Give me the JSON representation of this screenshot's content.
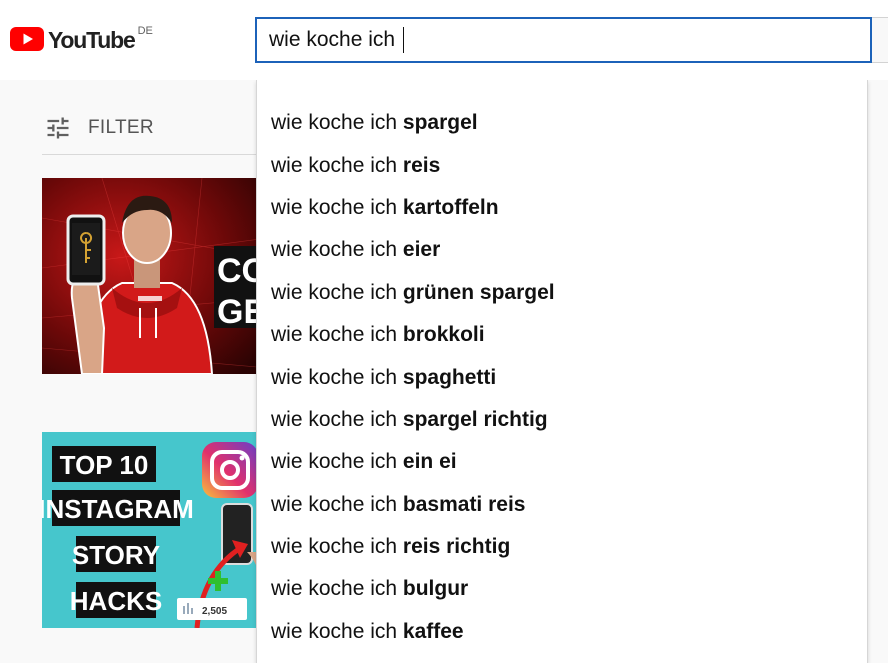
{
  "header": {
    "logo_text": "YouTube",
    "logo_region": "DE",
    "search_value": "wie koche ich "
  },
  "filter": {
    "label": "FILTER",
    "icon": "tune-icon"
  },
  "thumbnails": [
    {
      "text_lines": [
        "CO",
        "GE"
      ]
    },
    {
      "text_lines": [
        "TOP 10",
        "INSTAGRAM",
        "STORY",
        "HACKS"
      ],
      "badge": "2,505"
    }
  ],
  "suggestions": [
    {
      "prefix": "wie koche ich ",
      "completion": "spargel"
    },
    {
      "prefix": "wie koche ich ",
      "completion": "reis"
    },
    {
      "prefix": "wie koche ich ",
      "completion": "kartoffeln"
    },
    {
      "prefix": "wie koche ich ",
      "completion": "eier"
    },
    {
      "prefix": "wie koche ich ",
      "completion": "grünen spargel"
    },
    {
      "prefix": "wie koche ich ",
      "completion": "brokkoli"
    },
    {
      "prefix": "wie koche ich ",
      "completion": "spaghetti"
    },
    {
      "prefix": "wie koche ich ",
      "completion": "spargel richtig"
    },
    {
      "prefix": "wie koche ich ",
      "completion": "ein ei"
    },
    {
      "prefix": "wie koche ich ",
      "completion": "basmati reis"
    },
    {
      "prefix": "wie koche ich ",
      "completion": "reis richtig"
    },
    {
      "prefix": "wie koche ich ",
      "completion": "bulgur"
    },
    {
      "prefix": "wie koche ich ",
      "completion": "kaffee"
    }
  ],
  "colors": {
    "youtube_red": "#ff0000",
    "search_border": "#1c62b9"
  }
}
